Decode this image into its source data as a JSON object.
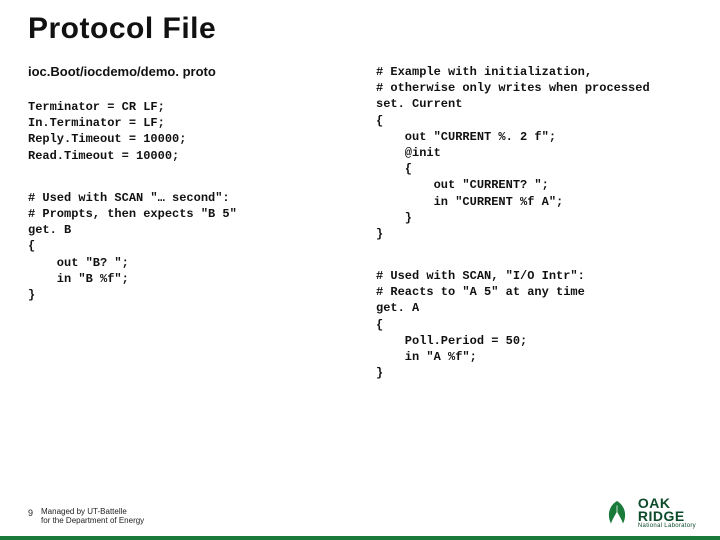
{
  "title": "Protocol File",
  "filepath": "ioc.Boot/iocdemo/demo. proto",
  "left": {
    "params": "Terminator = CR LF;\nIn.Terminator = LF;\nReply.Timeout = 10000;\nRead.Timeout = 10000;",
    "getB": "# Used with SCAN \"… second\":\n# Prompts, then expects \"B 5\"\nget. B\n{\n    out \"B? \";\n    in \"B %f\";\n}"
  },
  "right": {
    "setCurrent": "# Example with initialization,\n# otherwise only writes when processed\nset. Current\n{\n    out \"CURRENT %. 2 f\";\n    @init\n    {\n        out \"CURRENT? \";\n        in \"CURRENT %f A\";\n    }\n}",
    "getA": "# Used with SCAN, \"I/O Intr\":\n# Reacts to \"A 5\" at any time\nget. A\n{\n    Poll.Period = 50;\n    in \"A %f\";\n}"
  },
  "footer": {
    "page": "9",
    "managed_line1": "Managed by UT-Battelle",
    "managed_line2": "for the Department of Energy"
  },
  "logo": {
    "top": "OAK",
    "bot": "RIDGE",
    "sub": "National Laboratory"
  }
}
